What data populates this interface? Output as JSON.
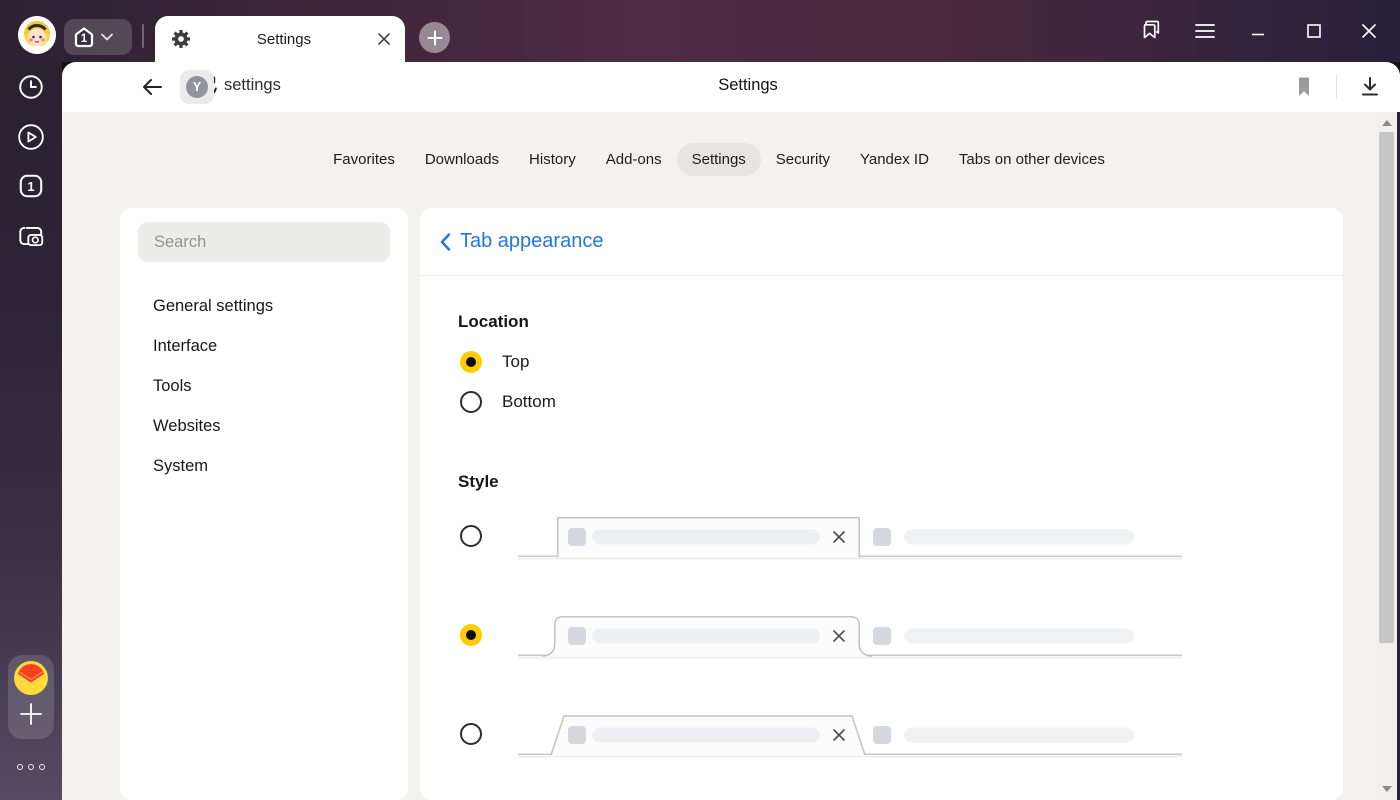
{
  "titlebar": {
    "tab_counter": "1",
    "active_tab": {
      "title": "Settings"
    },
    "window_controls": [
      "minimize",
      "maximize",
      "close"
    ]
  },
  "toolbar": {
    "address": "settings",
    "page_title": "Settings"
  },
  "rail": {
    "tab_count": "1"
  },
  "nav": {
    "items": [
      {
        "label": "Favorites",
        "active": false
      },
      {
        "label": "Downloads",
        "active": false
      },
      {
        "label": "History",
        "active": false
      },
      {
        "label": "Add-ons",
        "active": false
      },
      {
        "label": "Settings",
        "active": true
      },
      {
        "label": "Security",
        "active": false
      },
      {
        "label": "Yandex ID",
        "active": false
      },
      {
        "label": "Tabs on other devices",
        "active": false
      }
    ]
  },
  "sidebar": {
    "search_placeholder": "Search",
    "items": [
      "General settings",
      "Interface",
      "Tools",
      "Websites",
      "System"
    ]
  },
  "content": {
    "title": "Tab appearance",
    "location": {
      "heading": "Location",
      "options": [
        {
          "label": "Top",
          "selected": true
        },
        {
          "label": "Bottom",
          "selected": false
        }
      ]
    },
    "style": {
      "heading": "Style",
      "options": [
        {
          "shape": "square",
          "selected": false
        },
        {
          "shape": "rounded",
          "selected": true
        },
        {
          "shape": "slanted",
          "selected": false
        }
      ]
    }
  },
  "icons": {
    "tab": "gear-icon",
    "address_badge": "yandex-y-icon",
    "rail": [
      "history-clock-icon",
      "play-icon",
      "tabs-count-icon",
      "screenshot-icon"
    ],
    "titlebar_right": [
      "collections-icon",
      "menu-icon",
      "minimize-icon",
      "maximize-icon",
      "close-icon"
    ]
  },
  "colors": {
    "accent_blue": "#2376e5",
    "radio_yellow": "#ffcc00",
    "active_nav_pill": "#e6e5e3",
    "page_background": "#f3f2ef"
  }
}
